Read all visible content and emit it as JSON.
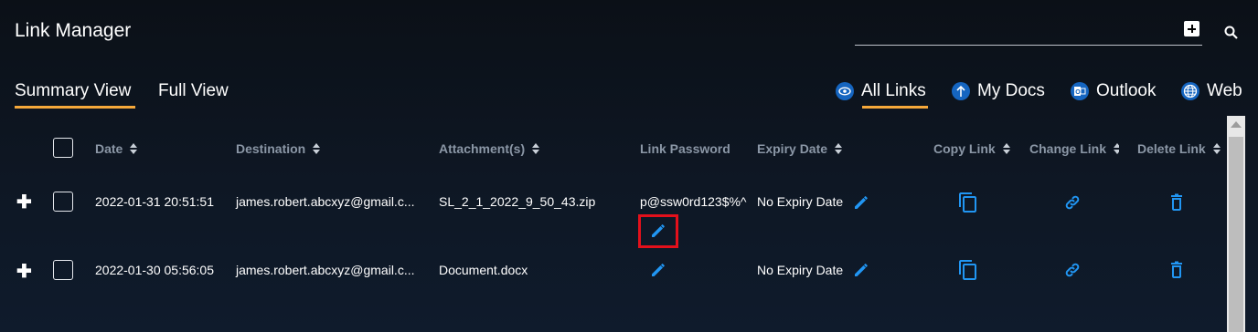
{
  "header": {
    "title": "Link Manager",
    "search_placeholder": ""
  },
  "tabs": [
    {
      "label": "Summary View",
      "active": true
    },
    {
      "label": "Full View",
      "active": false
    }
  ],
  "filters": [
    {
      "label": "All Links",
      "icon": "eye-icon",
      "active": true
    },
    {
      "label": "My Docs",
      "icon": "upload-icon",
      "active": false
    },
    {
      "label": "Outlook",
      "icon": "outlook-icon",
      "active": false
    },
    {
      "label": "Web",
      "icon": "globe-icon",
      "active": false
    }
  ],
  "columns": {
    "date": "Date",
    "destination": "Destination",
    "attachments": "Attachment(s)",
    "link_password": "Link Password",
    "expiry_date": "Expiry Date",
    "copy_link": "Copy Link",
    "change_link": "Change Link",
    "delete_link": "Delete Link"
  },
  "rows": [
    {
      "date": "2022-01-31 20:51:51",
      "destination": "james.robert.abcxyz@gmail.c...",
      "attachment": "SL_2_1_2022_9_50_43.zip",
      "password": "p@ssw0rd123$%^",
      "expiry": "No Expiry Date"
    },
    {
      "date": "2022-01-30 05:56:05",
      "destination": "james.robert.abcxyz@gmail.c...",
      "attachment": "Document.docx",
      "password": "",
      "expiry": "No Expiry Date"
    }
  ],
  "colors": {
    "accent": "#f5a83a",
    "icon_blue": "#2196f3",
    "highlight": "#e3101b"
  }
}
